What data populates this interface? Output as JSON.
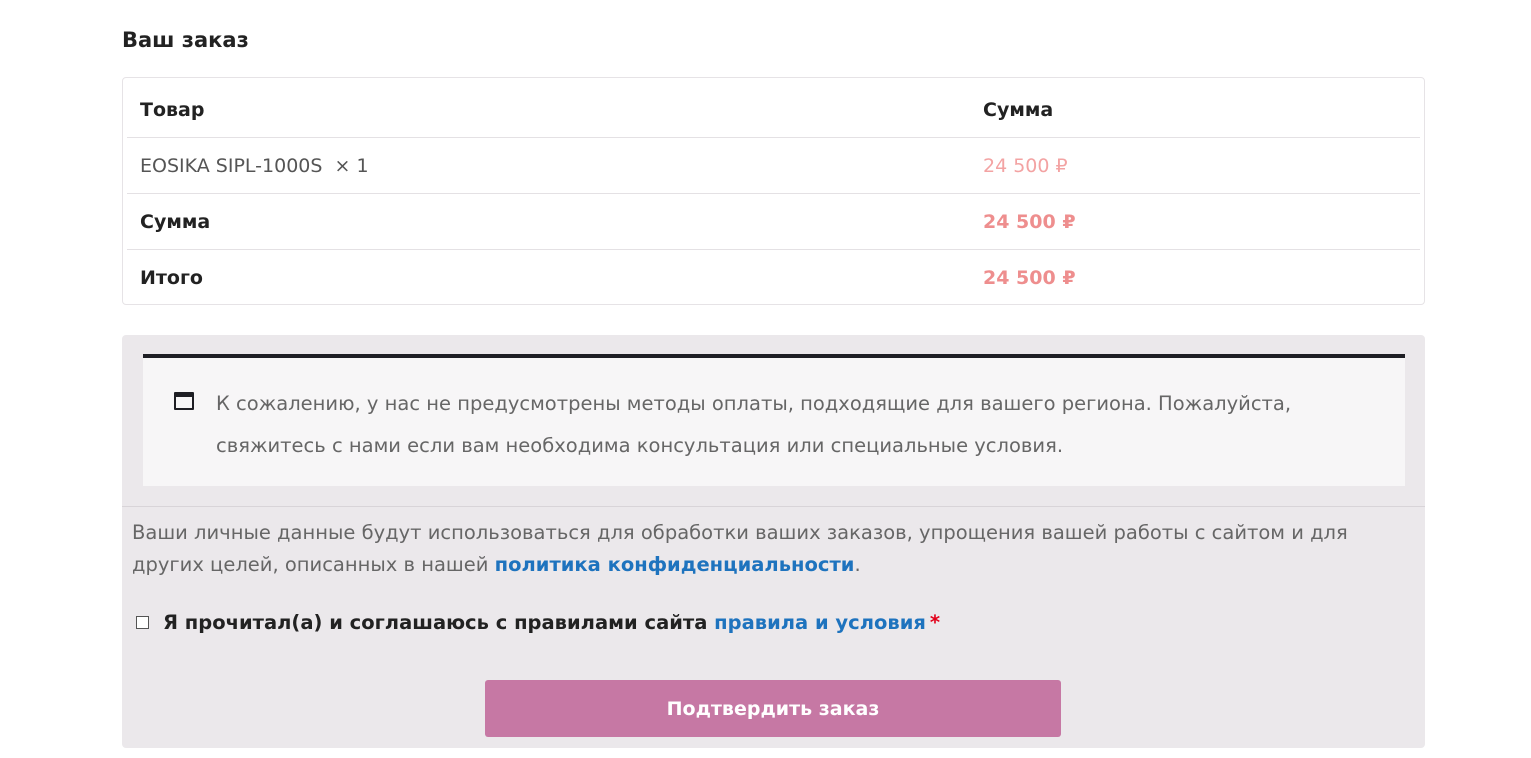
{
  "order": {
    "title": "Ваш заказ",
    "table": {
      "header": {
        "product": "Товар",
        "total": "Сумма"
      },
      "items": [
        {
          "name": "EOSIKA SIPL-1000S",
          "quantity": "× 1",
          "price": "24 500 ₽"
        }
      ],
      "subtotal": {
        "label": "Сумма",
        "value": "24 500 ₽"
      },
      "total": {
        "label": "Итого",
        "value": "24 500 ₽"
      }
    }
  },
  "payment": {
    "notice_icon": "window-icon",
    "notice_text": "К сожалению, у нас не предусмотрены методы оплаты, подходящие для вашего региона. Пожалуйста, свяжитесь с нами если вам необходима консультация или специальные условия.",
    "privacy_text": "Ваши личные данные будут использоваться для обработки ваших заказов, упрощения вашей работы с сайтом и для других целей, описанных в нашей",
    "privacy_link": "политика конфиденциальности",
    "privacy_end": ".",
    "terms_text": "Я прочитал(а) и соглашаюсь с правилами сайта",
    "terms_link": "правила и условия",
    "terms_required": "*",
    "terms_checked": false,
    "submit_label": "Подтвердить заказ"
  },
  "colors": {
    "accent_button": "#c678a4",
    "price": "#ee8e8e",
    "link": "#1e73be",
    "required": "#e2001a"
  }
}
